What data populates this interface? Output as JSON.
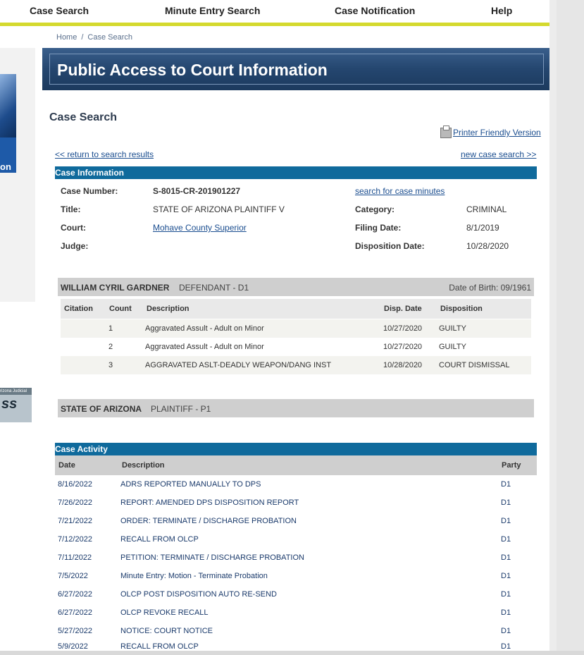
{
  "nav": {
    "case_search": "Case Search",
    "minute_entry_search": "Minute Entry Search",
    "case_notification": "Case Notification",
    "help": "Help"
  },
  "breadcrumb": {
    "home": "Home",
    "separator": "/",
    "current": "Case Search"
  },
  "banner": {
    "title": "Public Access to Court Information"
  },
  "left": {
    "logo_text": "on",
    "badge_text": "rizona Judicial",
    "badge_mark": "ss"
  },
  "page": {
    "heading": "Case Search",
    "printer_link": "Printer Friendly Version",
    "return_link": "<< return to search results",
    "new_search_link": "new case search >>"
  },
  "case_info": {
    "header": "Case Information",
    "case_number_label": "Case Number:",
    "case_number": "S-8015-CR-201901227",
    "minutes_link": "search for case minutes",
    "title_label": "Title:",
    "title": "STATE OF ARIZONA PLAINTIFF V",
    "category_label": "Category:",
    "category": "CRIMINAL",
    "court_label": "Court:",
    "court": "Mohave County Superior",
    "filing_date_label": "Filing Date:",
    "filing_date": "8/1/2019",
    "judge_label": "Judge:",
    "judge": "",
    "disposition_date_label": "Disposition Date:",
    "disposition_date": "10/28/2020"
  },
  "defendant": {
    "name": "WILLIAM CYRIL GARDNER",
    "role": "DEFENDANT  -  D1",
    "dob": "Date of Birth: 09/1961"
  },
  "charges": {
    "headers": {
      "citation": "Citation",
      "count": "Count",
      "description": "Description",
      "disp_date": "Disp. Date",
      "disposition": "Disposition"
    },
    "rows": [
      {
        "count": "1",
        "description": "Aggravated Assult - Adult on Minor",
        "disp_date": "10/27/2020",
        "disposition": "GUILTY"
      },
      {
        "count": "2",
        "description": "Aggravated Assult - Adult on Minor",
        "disp_date": "10/27/2020",
        "disposition": "GUILTY"
      },
      {
        "count": "3",
        "description": "AGGRAVATED ASLT-DEADLY WEAPON/DANG INST",
        "disp_date": "10/28/2020",
        "disposition": "COURT DISMISSAL"
      }
    ]
  },
  "plaintiff": {
    "name": "STATE OF ARIZONA",
    "role": "PLAINTIFF  -  P1"
  },
  "activity": {
    "header": "Case Activity",
    "headers": {
      "date": "Date",
      "description": "Description",
      "party": "Party"
    },
    "rows": [
      {
        "date": "8/16/2022",
        "description": "ADRS REPORTED MANUALLY TO DPS",
        "party": "D1"
      },
      {
        "date": "7/26/2022",
        "description": "REPORT: AMENDED DPS DISPOSITION REPORT",
        "party": "D1"
      },
      {
        "date": "7/21/2022",
        "description": "ORDER: TERMINATE / DISCHARGE PROBATION",
        "party": "D1"
      },
      {
        "date": "7/12/2022",
        "description": "RECALL FROM OLCP",
        "party": "D1"
      },
      {
        "date": "7/11/2022",
        "description": "PETITION: TERMINATE / DISCHARGE PROBATION",
        "party": "D1"
      },
      {
        "date": "7/5/2022",
        "description": "Minute Entry: Motion - Terminate Probation",
        "party": "D1"
      },
      {
        "date": "6/27/2022",
        "description": "OLCP POST DISPOSITION AUTO RE-SEND",
        "party": "D1"
      },
      {
        "date": "6/27/2022",
        "description": "OLCP REVOKE RECALL",
        "party": "D1"
      },
      {
        "date": "5/27/2022",
        "description": "NOTICE: COURT NOTICE",
        "party": "D1"
      },
      {
        "date": "5/9/2022",
        "description": "RECALL FROM OLCP",
        "party": "D1"
      }
    ]
  }
}
